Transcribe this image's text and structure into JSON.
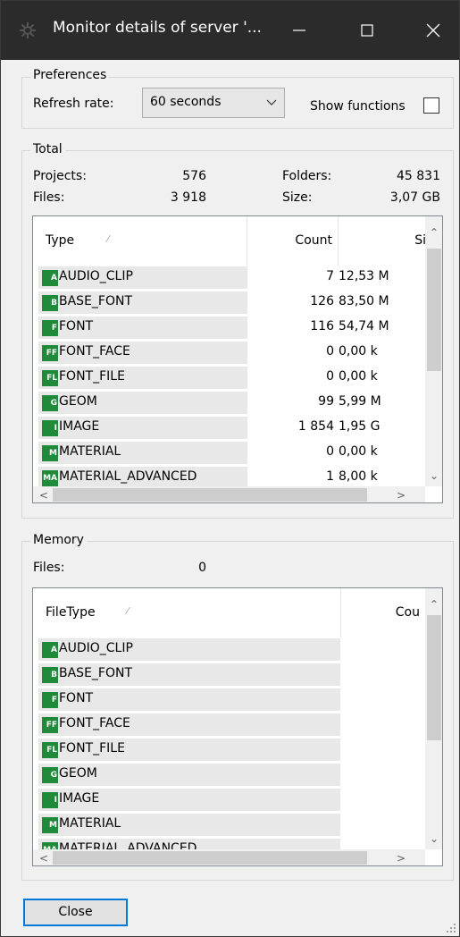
{
  "window": {
    "title": "Monitor details of server '...",
    "controls": [
      "minimize",
      "maximize",
      "close"
    ]
  },
  "preferences": {
    "legend": "Preferences",
    "refresh_label": "Refresh rate:",
    "refresh_value": "60 seconds",
    "show_functions_label": "Show functions",
    "show_functions_checked": false
  },
  "total": {
    "legend": "Total",
    "projects_label": "Projects:",
    "projects_value": "576",
    "folders_label": "Folders:",
    "folders_value": "45 831",
    "files_label": "Files:",
    "files_value": "3 918",
    "size_label": "Size:",
    "size_value": "3,07 GB",
    "table": {
      "columns": [
        "Type",
        "Count",
        "Si"
      ],
      "sort_indicator": "⁄",
      "rows": [
        {
          "icon": "A",
          "type": "AUDIO_CLIP",
          "count": "7",
          "size": "12,53 M"
        },
        {
          "icon": "B",
          "type": "BASE_FONT",
          "count": "126",
          "size": "83,50 M"
        },
        {
          "icon": "F",
          "type": "FONT",
          "count": "116",
          "size": "54,74 M"
        },
        {
          "icon": "FF",
          "type": "FONT_FACE",
          "count": "0",
          "size": "0,00 k"
        },
        {
          "icon": "FL",
          "type": "FONT_FILE",
          "count": "0",
          "size": "0,00 k"
        },
        {
          "icon": "G",
          "type": "GEOM",
          "count": "99",
          "size": "5,99 M"
        },
        {
          "icon": "I",
          "type": "IMAGE",
          "count": "1 854",
          "size": "1,95 G"
        },
        {
          "icon": "M",
          "type": "MATERIAL",
          "count": "0",
          "size": "0,00 k"
        },
        {
          "icon": "MA",
          "type": "MATERIAL_ADVANCED",
          "count": "1",
          "size": "8,00 k"
        }
      ]
    }
  },
  "memory": {
    "legend": "Memory",
    "files_label": "Files:",
    "files_value": "0",
    "table": {
      "columns": [
        "FileType",
        "Cou"
      ],
      "sort_indicator": "⁄",
      "rows": [
        {
          "icon": "A",
          "type": "AUDIO_CLIP"
        },
        {
          "icon": "B",
          "type": "BASE_FONT"
        },
        {
          "icon": "F",
          "type": "FONT"
        },
        {
          "icon": "FF",
          "type": "FONT_FACE"
        },
        {
          "icon": "FL",
          "type": "FONT_FILE"
        },
        {
          "icon": "G",
          "type": "GEOM"
        },
        {
          "icon": "I",
          "type": "IMAGE"
        },
        {
          "icon": "M",
          "type": "MATERIAL"
        },
        {
          "icon": "MA",
          "type": "MATERIAL_ADVANCED"
        }
      ]
    }
  },
  "footer": {
    "close_label": "Close"
  },
  "colors": {
    "titlebar": "#2b2b2b",
    "type_icon": "#1f8a3a",
    "focus_border": "#0078d7"
  }
}
